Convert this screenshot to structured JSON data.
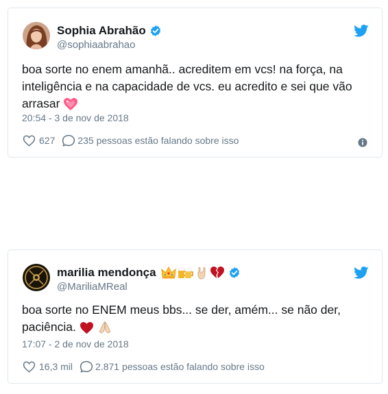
{
  "tweets": [
    {
      "name": "Sophia Abrahão",
      "handle": "@sophiaabrahao",
      "text": "boa sorte no enem amanhã.. acreditem em vcs! na força, na inteligência e na capacidade de vcs. eu acredito e sei que vão arrasar",
      "timestamp": "20:54 - 3 de nov de 2018",
      "likes": "627",
      "replies_text": "235 pessoas estão falando sobre isso",
      "verified": true,
      "emoji": [
        "sparkling-heart"
      ]
    },
    {
      "name": "marilia mendonça",
      "handle": "@MariliaMReal",
      "text": "boa sorte no ENEM meus bbs... se der, amém... se não der, paciência.",
      "timestamp": "17:07 - 2 de nov de 2018",
      "likes": "16,3 mil",
      "replies_text": "2.871 pessoas estão falando sobre isso",
      "verified": true,
      "name_emoji": [
        "crown",
        "beer-mugs",
        "rock-on-hand",
        "broken-heart"
      ],
      "emoji": [
        "red-heart",
        "folded-hands"
      ]
    }
  ],
  "colors": {
    "accent": "#1da1f2",
    "text": "#14171a",
    "secondary": "#657786",
    "border": "#e1e8ed"
  }
}
